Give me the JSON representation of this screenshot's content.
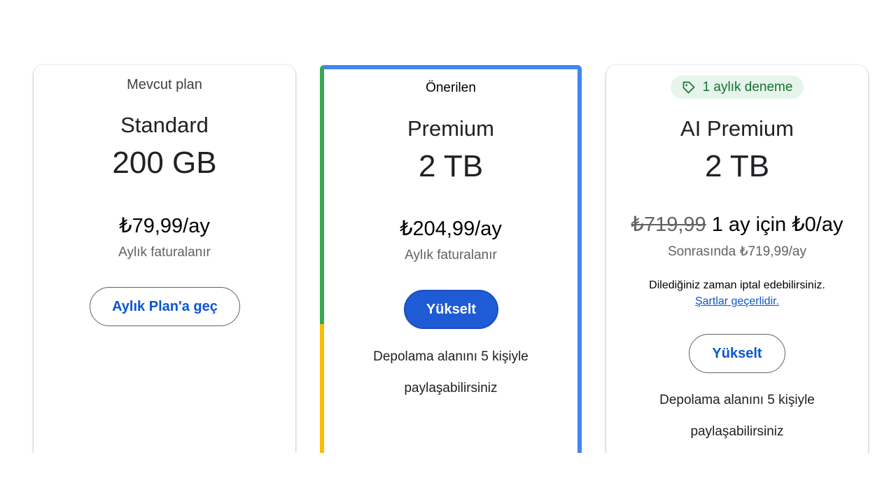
{
  "plans": [
    {
      "label": "Mevcut plan",
      "name": "Standard",
      "storage": "200 GB",
      "price": "₺79,99/ay",
      "billing": "Aylık faturalanır",
      "button": "Aylık Plan'a geç"
    },
    {
      "label": "Önerilen",
      "name": "Premium",
      "storage": "2 TB",
      "price": "₺204,99/ay",
      "billing": "Aylık faturalanır",
      "button": "Yükselt",
      "feature_line1": "Depolama alanını 5 kişiyle",
      "feature_line2": "paylaşabilirsiniz"
    },
    {
      "badge": "1 aylık deneme",
      "badge_icon": "tag-icon",
      "name": "AI Premium",
      "storage": "2 TB",
      "old_price": "₺719,99",
      "price": "1 ay için ₺0/ay",
      "billing": "Sonrasında ₺719,99/ay",
      "cancel_note": "Dilediğiniz zaman iptal edebilirsiniz.",
      "terms_link": "Şartlar geçerlidir.",
      "button": "Yükselt",
      "feature_line1": "Depolama alanını 5 kişiyle",
      "feature_line2": "paylaşabilirsiniz"
    }
  ],
  "colors": {
    "accent_blue": "#4285f4",
    "green": "#34a853",
    "yellow": "#fbbc04",
    "button_blue": "#1f5bd5",
    "link_blue": "#0b57d0",
    "badge_bg": "#e6f4ea"
  }
}
